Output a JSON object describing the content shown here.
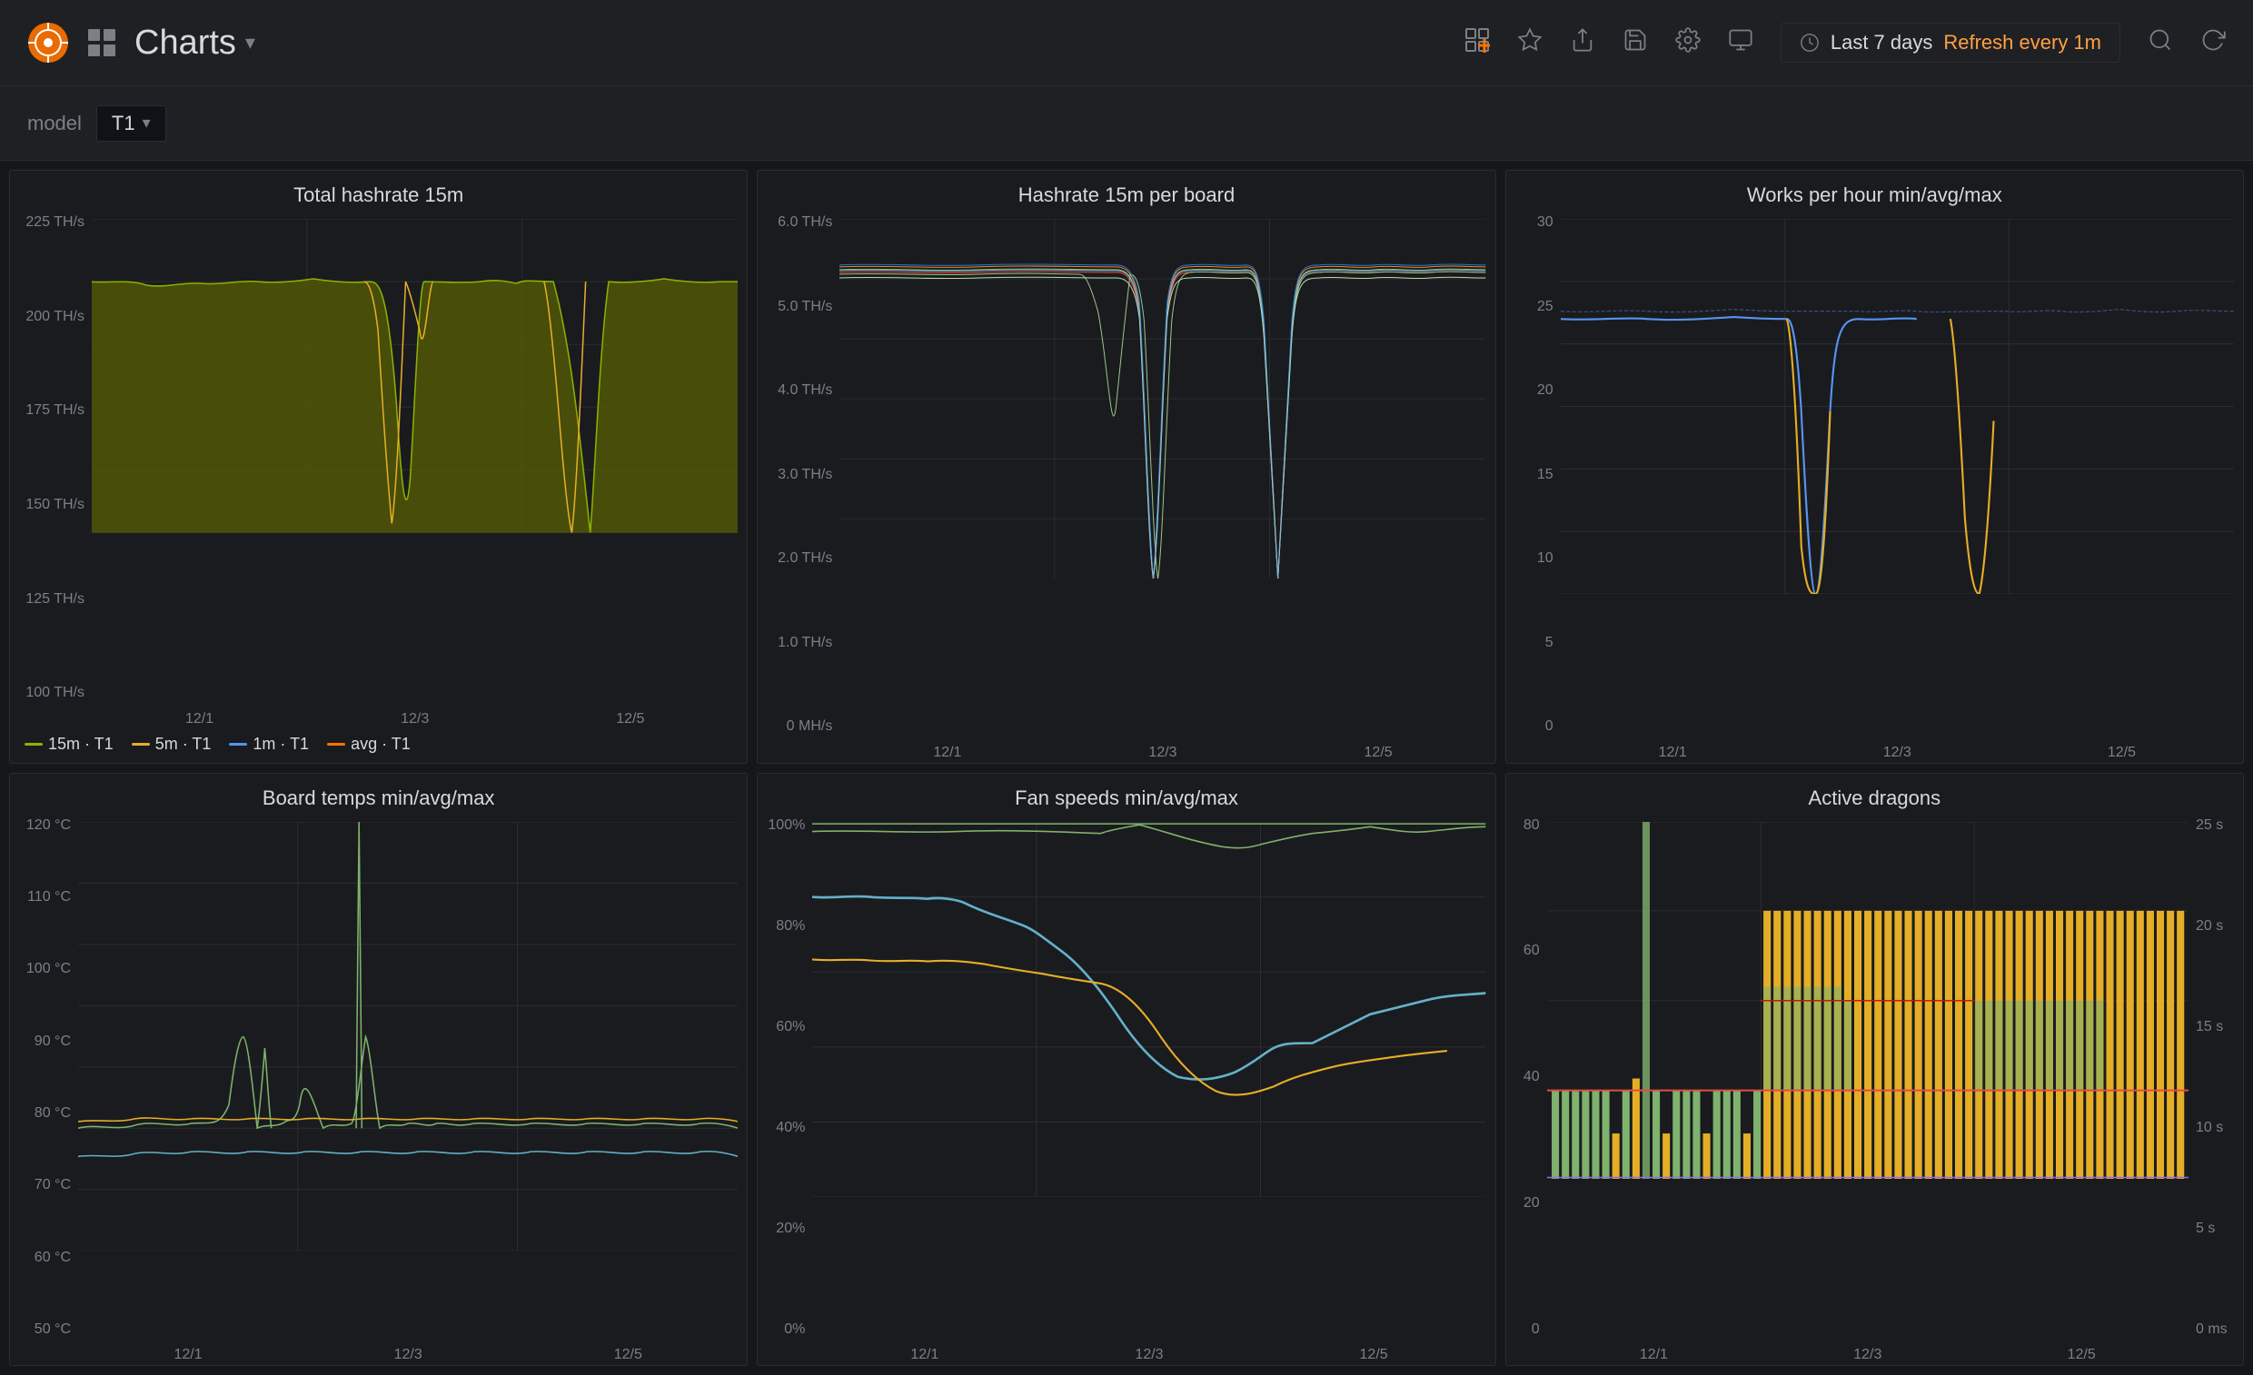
{
  "header": {
    "logo_alt": "Grafana",
    "grid_icon": "⊞",
    "title": "Charts",
    "title_arrow": "▾",
    "icons": [
      {
        "name": "add-panel-icon",
        "symbol": "📊",
        "label": "Add panel"
      },
      {
        "name": "star-icon",
        "symbol": "★",
        "label": "Star"
      },
      {
        "name": "share-icon",
        "symbol": "↗",
        "label": "Share"
      },
      {
        "name": "save-icon",
        "symbol": "💾",
        "label": "Save"
      },
      {
        "name": "settings-icon",
        "symbol": "⚙",
        "label": "Settings"
      },
      {
        "name": "tv-icon",
        "symbol": "🖥",
        "label": "TV mode"
      }
    ],
    "time_range": {
      "icon": "🕐",
      "range": "Last 7 days",
      "refresh": "Refresh every 1m"
    },
    "search_icon": "🔍",
    "refresh_icon": "↺"
  },
  "filter_bar": {
    "label": "model",
    "select_value": "T1",
    "select_arrow": "▾"
  },
  "charts": [
    {
      "id": "total-hashrate",
      "title": "Total hashrate 15m",
      "y_labels": [
        "225 TH/s",
        "200 TH/s",
        "175 TH/s",
        "150 TH/s",
        "125 TH/s",
        "100 TH/s"
      ],
      "x_labels": [
        "12/1",
        "12/3",
        "12/5"
      ],
      "legend": [
        {
          "color": "#8cb300",
          "label": "15m · T1"
        },
        {
          "color": "#e5ae27",
          "label": "5m · T1"
        },
        {
          "color": "#5794f2",
          "label": "1m · T1"
        },
        {
          "color": "#ff7300",
          "label": "avg · T1"
        }
      ],
      "type": "area"
    },
    {
      "id": "hashrate-per-board",
      "title": "Hashrate 15m per board",
      "y_labels": [
        "6.0 TH/s",
        "5.0 TH/s",
        "4.0 TH/s",
        "3.0 TH/s",
        "2.0 TH/s",
        "1.0 TH/s",
        "0 MH/s"
      ],
      "x_labels": [
        "12/1",
        "12/3",
        "12/5"
      ],
      "legend": [],
      "type": "multiline"
    },
    {
      "id": "works-per-hour",
      "title": "Works per hour min/avg/max",
      "y_labels": [
        "30",
        "25",
        "20",
        "15",
        "10",
        "5",
        "0"
      ],
      "x_labels": [
        "12/1",
        "12/3",
        "12/5"
      ],
      "legend": [],
      "type": "line"
    },
    {
      "id": "board-temps",
      "title": "Board temps min/avg/max",
      "y_labels": [
        "120 °C",
        "110 °C",
        "100 °C",
        "90 °C",
        "80 °C",
        "70 °C",
        "60 °C",
        "50 °C"
      ],
      "x_labels": [
        "12/1",
        "12/3",
        "12/5"
      ],
      "legend": [],
      "type": "line"
    },
    {
      "id": "fan-speeds",
      "title": "Fan speeds min/avg/max",
      "y_labels": [
        "100%",
        "80%",
        "60%",
        "40%",
        "20%",
        "0%"
      ],
      "x_labels": [
        "12/1",
        "12/3",
        "12/5"
      ],
      "legend": [],
      "type": "line"
    },
    {
      "id": "active-dragons",
      "title": "Active dragons",
      "y_labels_left": [
        "80",
        "60",
        "40",
        "20",
        "0"
      ],
      "y_labels_right": [
        "25 s",
        "20 s",
        "15 s",
        "10 s",
        "5 s",
        "0 ms"
      ],
      "x_labels": [
        "12/1",
        "12/3",
        "12/5"
      ],
      "legend": [],
      "type": "bar"
    }
  ]
}
